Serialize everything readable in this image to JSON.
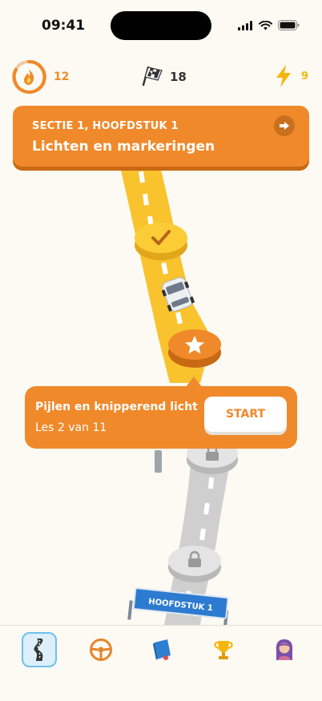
{
  "status_bar": {
    "time": "09:41"
  },
  "stats": {
    "streak": "12",
    "flags": "18",
    "energy": "9"
  },
  "section": {
    "subtitle": "SECTIE 1, HOOFDSTUK 1",
    "title": "Lichten en markeringen"
  },
  "lesson": {
    "title": "Pijlen en knipperend licht",
    "progress": "Les 2 van 11",
    "start_label": "START"
  },
  "sign": {
    "label": "HOOFDSTUK 1"
  },
  "nodes": [
    {
      "state": "completed",
      "icon": "checkmark-icon"
    },
    {
      "state": "current",
      "icon": "star-icon"
    },
    {
      "state": "locked",
      "icon": "lock-icon"
    },
    {
      "state": "locked",
      "icon": "lock-icon"
    }
  ],
  "tabs": [
    {
      "name": "road",
      "icon": "road-icon",
      "active": true
    },
    {
      "name": "steering",
      "icon": "steering-wheel-icon",
      "active": false
    },
    {
      "name": "book",
      "icon": "book-icon",
      "active": false
    },
    {
      "name": "trophy",
      "icon": "trophy-icon",
      "active": false
    },
    {
      "name": "profile",
      "icon": "avatar-icon",
      "active": false
    }
  ],
  "colors": {
    "accent": "#F0892A",
    "accent_dark": "#C86A14",
    "road_active": "#F9C32E",
    "road_locked": "#CFCFCF",
    "energy": "#F5B60C",
    "sign_blue": "#2D7BD0"
  }
}
